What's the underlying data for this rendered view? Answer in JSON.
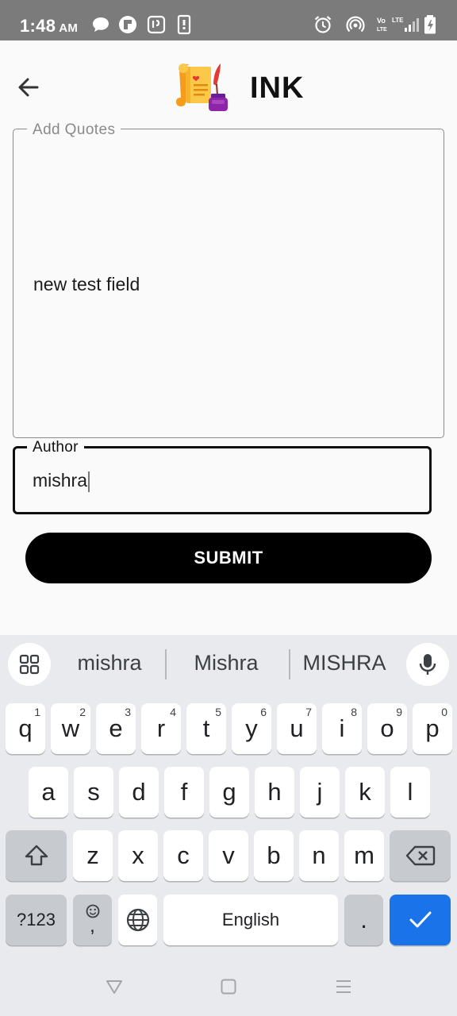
{
  "status_bar": {
    "time": "1:48",
    "ampm": "AM",
    "left_icons": [
      "chat-icon",
      "flipboard-icon",
      "notification-app-icon",
      "sim-icon"
    ],
    "right_icons": [
      "alarm-icon",
      "hotspot-icon",
      "volte-icon",
      "signal-icon",
      "battery-charging-icon"
    ],
    "volte_label": "Vo LTE",
    "lte_label": "LTE"
  },
  "app_bar": {
    "title": "INK",
    "back_icon": "arrow-left-icon",
    "logo_icon": "scroll-and-quill-icon"
  },
  "form": {
    "quote_label": "Add Quotes",
    "quote_value": "new test field",
    "author_label": "Author",
    "author_value": "mishra",
    "submit_label": "SUBMIT"
  },
  "keyboard": {
    "suggestions": [
      "mishra",
      "Mishra",
      "MISHRA"
    ],
    "row1": [
      {
        "k": "q",
        "h": "1"
      },
      {
        "k": "w",
        "h": "2"
      },
      {
        "k": "e",
        "h": "3"
      },
      {
        "k": "r",
        "h": "4"
      },
      {
        "k": "t",
        "h": "5"
      },
      {
        "k": "y",
        "h": "6"
      },
      {
        "k": "u",
        "h": "7"
      },
      {
        "k": "i",
        "h": "8"
      },
      {
        "k": "o",
        "h": "9"
      },
      {
        "k": "p",
        "h": "0"
      }
    ],
    "row2": [
      "a",
      "s",
      "d",
      "f",
      "g",
      "h",
      "j",
      "k",
      "l"
    ],
    "row3": [
      "z",
      "x",
      "c",
      "v",
      "b",
      "n",
      "m"
    ],
    "symbols_label": "?123",
    "comma_label": ",",
    "space_label": "English",
    "period_label": ".",
    "accent_color": "#1a73e8"
  }
}
